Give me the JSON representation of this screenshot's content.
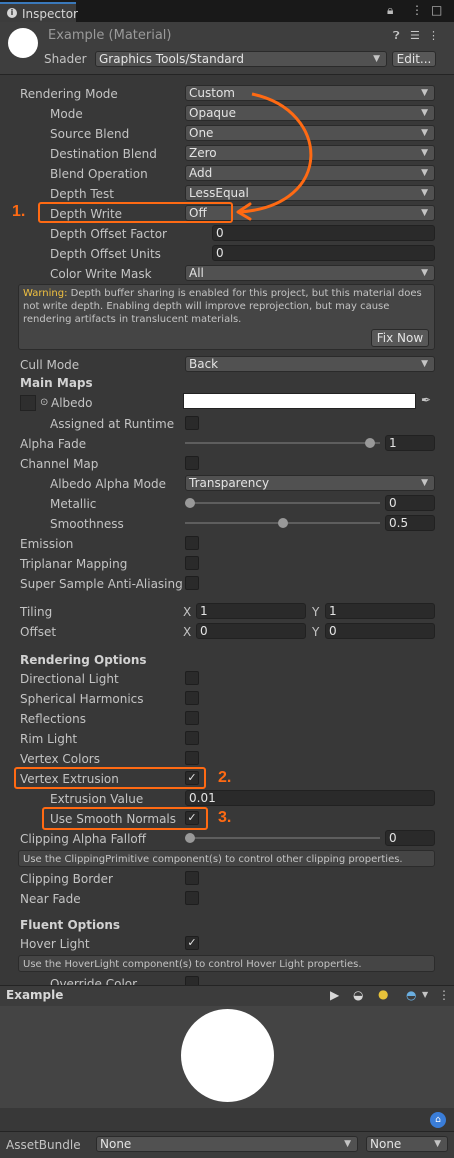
{
  "tab": {
    "title": "Inspector"
  },
  "header": {
    "title": "Example (Material)",
    "shader_label": "Shader",
    "shader_value": "Graphics Tools/Standard",
    "edit_label": "Edit..."
  },
  "rows": {
    "rendering_mode": {
      "label": "Rendering Mode",
      "value": "Custom"
    },
    "mode": {
      "label": "Mode",
      "value": "Opaque"
    },
    "source_blend": {
      "label": "Source Blend",
      "value": "One"
    },
    "destination_blend": {
      "label": "Destination Blend",
      "value": "Zero"
    },
    "blend_operation": {
      "label": "Blend Operation",
      "value": "Add"
    },
    "depth_test": {
      "label": "Depth Test",
      "value": "LessEqual"
    },
    "depth_write": {
      "label": "Depth Write",
      "value": "Off"
    },
    "depth_offset_factor": {
      "label": "Depth Offset Factor",
      "value": "0"
    },
    "depth_offset_units": {
      "label": "Depth Offset Units",
      "value": "0"
    },
    "color_write_mask": {
      "label": "Color Write Mask",
      "value": "All"
    },
    "cull_mode": {
      "label": "Cull Mode",
      "value": "Back"
    },
    "main_maps": {
      "label": "Main Maps"
    },
    "albedo": {
      "label": "Albedo"
    },
    "assigned_at_runtime": {
      "label": "Assigned at Runtime"
    },
    "alpha_fade": {
      "label": "Alpha Fade",
      "value": "1",
      "fill": 1.0
    },
    "channel_map": {
      "label": "Channel Map"
    },
    "albedo_alpha_mode": {
      "label": "Albedo Alpha Mode",
      "value": "Transparency"
    },
    "metallic": {
      "label": "Metallic",
      "value": "0",
      "fill": 0.0
    },
    "smoothness": {
      "label": "Smoothness",
      "value": "0.5",
      "fill": 0.5
    },
    "emission": {
      "label": "Emission"
    },
    "triplanar_mapping": {
      "label": "Triplanar Mapping"
    },
    "super_sample": {
      "label": "Super Sample Anti-Aliasing"
    },
    "tiling": {
      "label": "Tiling",
      "x_label": "X",
      "x": "1",
      "y_label": "Y",
      "y": "1"
    },
    "offset": {
      "label": "Offset",
      "x_label": "X",
      "x": "0",
      "y_label": "Y",
      "y": "0"
    },
    "rendering_options": {
      "label": "Rendering Options"
    },
    "directional_light": {
      "label": "Directional Light"
    },
    "spherical_harmonics": {
      "label": "Spherical Harmonics"
    },
    "reflections": {
      "label": "Reflections"
    },
    "rim_light": {
      "label": "Rim Light"
    },
    "vertex_colors": {
      "label": "Vertex Colors"
    },
    "vertex_extrusion": {
      "label": "Vertex Extrusion",
      "check": "✓"
    },
    "extrusion_value": {
      "label": "Extrusion Value",
      "value": "0.01"
    },
    "use_smooth_normals": {
      "label": "Use Smooth Normals",
      "check": "✓"
    },
    "clipping_alpha_falloff": {
      "label": "Clipping Alpha Falloff",
      "value": "0",
      "fill": 0.0
    },
    "clipping_border": {
      "label": "Clipping Border"
    },
    "near_fade": {
      "label": "Near Fade"
    },
    "fluent_options": {
      "label": "Fluent Options"
    },
    "hover_light": {
      "label": "Hover Light",
      "check": "✓"
    },
    "override_color": {
      "label": "Override Color"
    }
  },
  "warning": {
    "prefix": "Warning:",
    "text": " Depth buffer sharing is enabled for this project, but this material does not write depth. Enabling depth will improve reprojection, but may cause rendering artifacts in translucent materials.",
    "fix_label": "Fix Now"
  },
  "help": {
    "clipping": "Use the ClippingPrimitive component(s) to control other clipping properties.",
    "hover": "Use the HoverLight component(s) to control Hover Light properties."
  },
  "annotations": {
    "one": "1.",
    "two": "2.",
    "three": "3."
  },
  "preview": {
    "title": "Example"
  },
  "bottom": {
    "label": "AssetBundle",
    "value1": "None",
    "value2": "None"
  },
  "colors": {
    "annotation": "#ff6a13",
    "panel": "#383838",
    "header": "#3e3e3e"
  }
}
